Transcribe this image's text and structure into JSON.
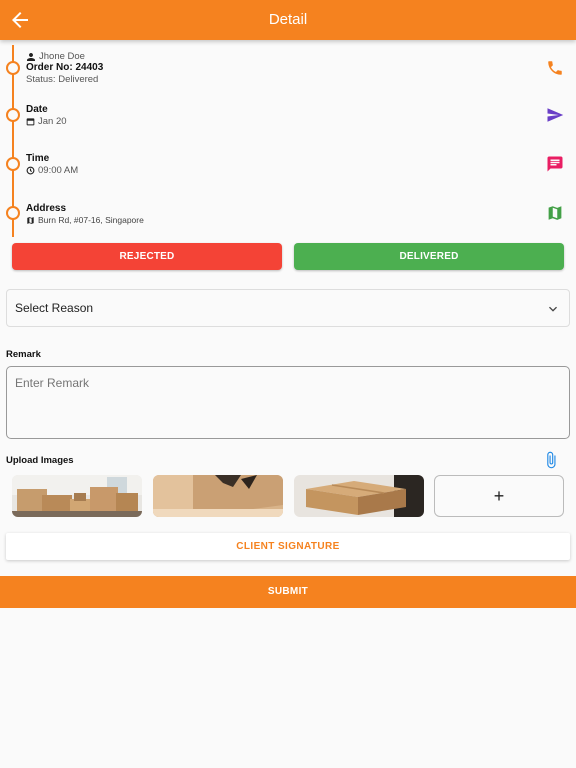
{
  "appbar": {
    "title": "Detail",
    "back_icon": "arrow-left-icon"
  },
  "order": {
    "customer_name": "Jhone Doe",
    "order_no": "Order No: 24403",
    "status": "Status: Delivered",
    "date_label": "Date",
    "date_value": "Jan 20",
    "time_label": "Time",
    "time_value": "09:00 AM",
    "address_label": "Address",
    "address_value": "Burn Rd, #07-16, Singapore"
  },
  "actions": {
    "phone_icon": "phone-icon",
    "send_icon": "send-icon",
    "message_icon": "message-icon",
    "map_icon": "map-icon"
  },
  "buttons": {
    "rejected": "REJECTED",
    "delivered": "DELIVERED"
  },
  "reason_select": {
    "value": "Select Reason"
  },
  "remark": {
    "label": "Remark",
    "placeholder": "Enter Remark"
  },
  "upload": {
    "label": "Upload Images",
    "add_label": "+"
  },
  "client_signature": "CLIENT SIGNATURE",
  "submit": "SUBMIT",
  "colors": {
    "primary": "#f5821f",
    "reject": "#f44336",
    "deliver": "#4caf50",
    "send": "#6a3fc7",
    "message": "#e91e63",
    "map": "#43a047",
    "clip": "#1e88e5"
  }
}
